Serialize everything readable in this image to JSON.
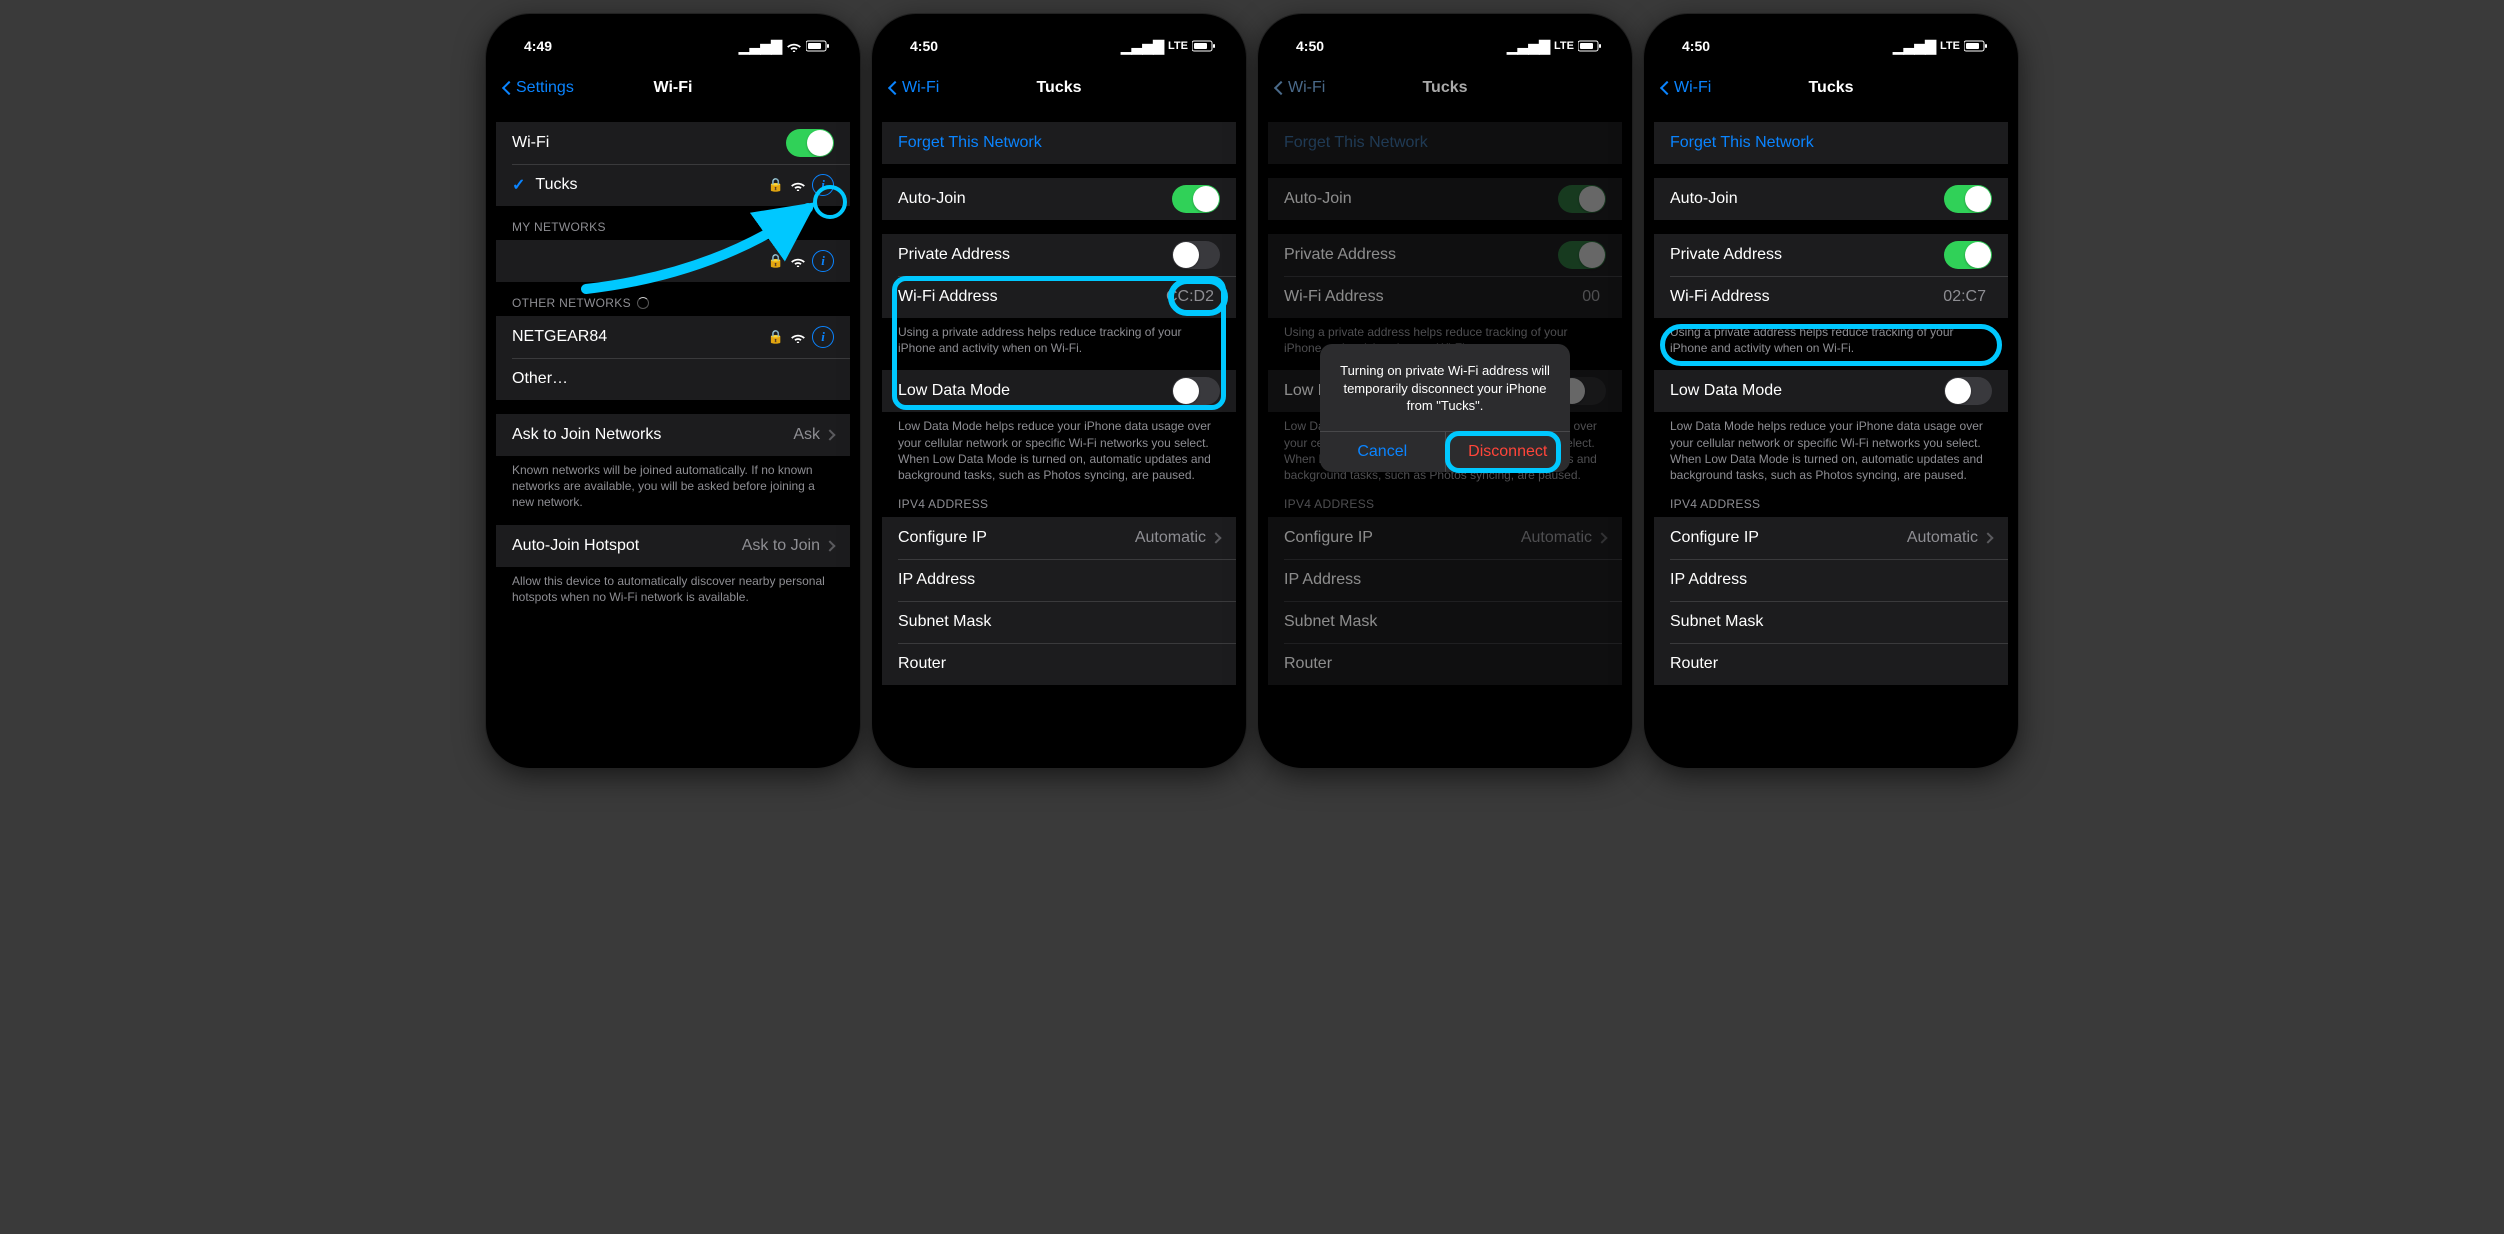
{
  "colors": {
    "accent": "#0a84ff",
    "green": "#30d158",
    "highlight": "#00c8ff",
    "destructive": "#ff453a"
  },
  "phone1": {
    "status": {
      "time": "4:49",
      "network": ""
    },
    "nav": {
      "back": "Settings",
      "title": "Wi-Fi"
    },
    "wifi_toggle_label": "Wi-Fi",
    "connected_network": "Tucks",
    "my_networks_header": "MY NETWORKS",
    "other_networks_header": "OTHER NETWORKS",
    "other_networks": [
      "NETGEAR84",
      "Other…"
    ],
    "ask_join_label": "Ask to Join Networks",
    "ask_join_value": "Ask",
    "ask_join_footer": "Known networks will be joined automatically. If no known networks are available, you will be asked before joining a new network.",
    "auto_hotspot_label": "Auto-Join Hotspot",
    "auto_hotspot_value": "Ask to Join",
    "auto_hotspot_footer": "Allow this device to automatically discover nearby personal hotspots when no Wi-Fi network is available."
  },
  "phone2": {
    "status": {
      "time": "4:50",
      "network": "LTE"
    },
    "nav": {
      "back": "Wi-Fi",
      "title": "Tucks"
    },
    "forget_label": "Forget This Network",
    "auto_join_label": "Auto-Join",
    "private_addr_label": "Private Address",
    "private_addr_on": false,
    "wifi_addr_label": "Wi-Fi Address",
    "wifi_addr_value": "CC:D2",
    "private_footer": "Using a private address helps reduce tracking of your iPhone and activity when on Wi-Fi.",
    "low_data_label": "Low Data Mode",
    "low_data_footer": "Low Data Mode helps reduce your iPhone data usage over your cellular network or specific Wi-Fi networks you select. When Low Data Mode is turned on, automatic updates and background tasks, such as Photos syncing, are paused.",
    "ipv4_header": "IPV4 ADDRESS",
    "configure_ip_label": "Configure IP",
    "configure_ip_value": "Automatic",
    "ip_addr_label": "IP Address",
    "subnet_label": "Subnet Mask",
    "router_label": "Router"
  },
  "phone3": {
    "status": {
      "time": "4:50",
      "network": "LTE"
    },
    "nav": {
      "back": "Wi-Fi",
      "title": "Tucks"
    },
    "private_addr_on": true,
    "wifi_addr_value": "00",
    "alert_text": "Turning on private Wi-Fi address will temporarily disconnect your iPhone from \"Tucks\".",
    "alert_cancel": "Cancel",
    "alert_disconnect": "Disconnect"
  },
  "phone4": {
    "status": {
      "time": "4:50",
      "network": "LTE"
    },
    "nav": {
      "back": "Wi-Fi",
      "title": "Tucks"
    },
    "private_addr_on": true,
    "wifi_addr_value": "02:C7"
  }
}
